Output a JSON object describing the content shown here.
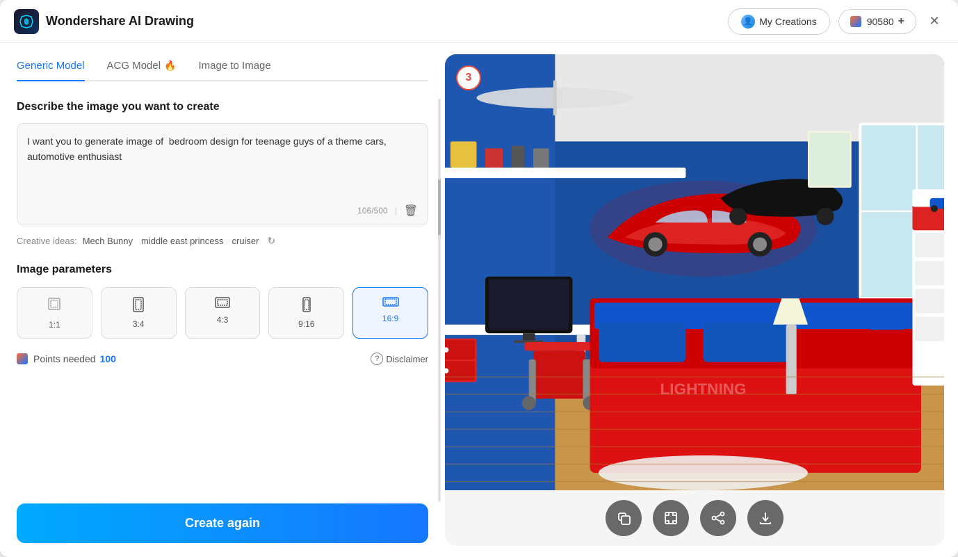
{
  "titleBar": {
    "appName": "Wondershare AI Drawing",
    "myCreations": "My Creations",
    "credits": "90580",
    "addCreditsLabel": "+",
    "closeLabel": "✕"
  },
  "tabs": [
    {
      "id": "generic",
      "label": "Generic Model",
      "active": true,
      "hasIcon": false
    },
    {
      "id": "acg",
      "label": "ACG Model",
      "active": false,
      "hasIcon": true
    },
    {
      "id": "imageToImage",
      "label": "Image to Image",
      "active": false,
      "hasIcon": false
    }
  ],
  "form": {
    "sectionTitle": "Describe the image you want to create",
    "promptText": "I want you to generate image of  bedroom design for teenage guys of a theme cars, automotive enthusiast",
    "charCount": "106/500",
    "creativeIdeasLabel": "Creative ideas:",
    "creativeIdeas": [
      "Mech Bunny",
      "middle east princess",
      "cruiser"
    ],
    "parametersTitle": "Image parameters",
    "ratioOptions": [
      {
        "id": "1:1",
        "label": "1:1",
        "active": false
      },
      {
        "id": "3:4",
        "label": "3:4",
        "active": false
      },
      {
        "id": "4:3",
        "label": "4:3",
        "active": false
      },
      {
        "id": "9:16",
        "label": "9:16",
        "active": false
      },
      {
        "id": "16:9",
        "label": "16:9",
        "active": true
      }
    ],
    "pointsLabel": "Points needed",
    "pointsValue": "100",
    "disclaimerLabel": "Disclaimer",
    "createBtnLabel": "Create again"
  },
  "imagePanel": {
    "badgeNumber": "3",
    "actionButtons": [
      {
        "id": "copy",
        "icon": "⊟",
        "label": "copy"
      },
      {
        "id": "expand",
        "icon": "⤢",
        "label": "expand"
      },
      {
        "id": "share",
        "icon": "⋯",
        "label": "share"
      },
      {
        "id": "download",
        "icon": "⬇",
        "label": "download"
      }
    ]
  }
}
